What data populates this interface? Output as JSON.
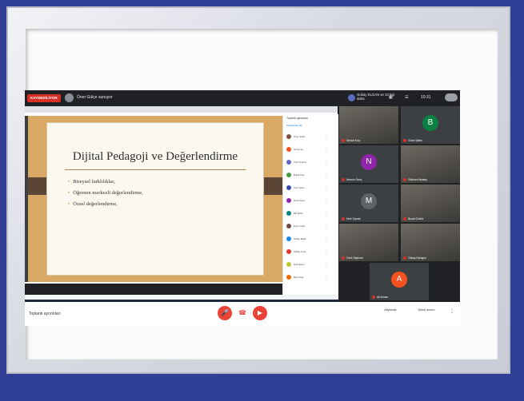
{
  "meet": {
    "recording_label": "KAYDEDİLİYOR",
    "presenter_text": "Öner Gülçe sunuyor",
    "top_right_names": "Gokay ELGAN ve 10 kişi daha",
    "time_label": "10:31",
    "colors": {
      "accent": "#ea4335",
      "background": "#202124",
      "slide": "#d9a865"
    }
  },
  "slide": {
    "title": "Dijital Pedagoji ve Değerlendirme",
    "bullets": [
      "Bireysel farklılıklar,",
      "Öğrenen merkezli değerlendirme,",
      "Özsel değerlendirme,"
    ]
  },
  "people_panel": {
    "title": "Toplantı ayrıntıları",
    "tab_label": "Katılımcılar (8)",
    "rows": [
      {
        "name": "Öner Gülçe",
        "color": "#795548"
      },
      {
        "name": "Ali Arman",
        "color": "#f4511e"
      },
      {
        "name": "Anıl Özdemir",
        "color": "#5c6bc0"
      },
      {
        "name": "Burak Kılıç",
        "color": "#43a047"
      },
      {
        "name": "Cem Aydın",
        "color": "#3949ab"
      },
      {
        "name": "Deniz Kara",
        "color": "#8e24aa"
      },
      {
        "name": "Elif Şahin",
        "color": "#00897b"
      },
      {
        "name": "Emre Yıldız",
        "color": "#6d4c41"
      },
      {
        "name": "Gökay Elgan",
        "color": "#1e88e5"
      },
      {
        "name": "Hakan Tuna",
        "color": "#e53935"
      },
      {
        "name": "İpek Demir",
        "color": "#c0ca33"
      },
      {
        "name": "Mert Usta",
        "color": "#ef6c00"
      }
    ]
  },
  "tiles": [
    {
      "name": "Serdar Kılıç",
      "initial": "",
      "color": "#3c4043"
    },
    {
      "name": "Güzel Şahin",
      "initial": "B",
      "color": "#0b8043"
    },
    {
      "name": "Nermin Genç",
      "initial": "N",
      "color": "#8e24aa"
    },
    {
      "name": "Gökhan Karataş",
      "initial": "",
      "color": "#3c4043"
    },
    {
      "name": "Mert Toprak",
      "initial": "M",
      "color": "#5f6368"
    },
    {
      "name": "Burak Öztürk",
      "initial": "",
      "color": "#3c4043"
    },
    {
      "name": "Cenk Taşkıran",
      "initial": "",
      "color": "#3c4043"
    },
    {
      "name": "Gökay Karagöz",
      "initial": "",
      "color": "#3c4043"
    },
    {
      "name": "Ali Arman",
      "initial": "A",
      "color": "#f4511e"
    }
  ],
  "controls": {
    "meeting_details": "Toplantı ayrıntıları",
    "mic_label": "",
    "hangup_label": "",
    "cam_label": "",
    "right_a": "Altyazılar",
    "right_b": "Şimdi sunun"
  }
}
